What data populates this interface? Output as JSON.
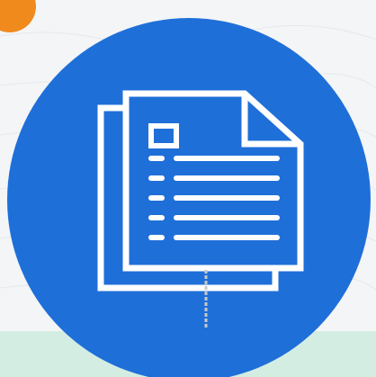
{
  "colors": {
    "background": "#f3f5f6",
    "mint_band": "#d4ede3",
    "accent_orange": "#f08a1c",
    "circle_blue": "#1f6fd9",
    "icon_stroke": "#ffffff",
    "connector_line": "#c8c8c8"
  },
  "icons": {
    "main": "document-stack-icon",
    "corner": "orange-circle",
    "connector": "vertical-line"
  }
}
